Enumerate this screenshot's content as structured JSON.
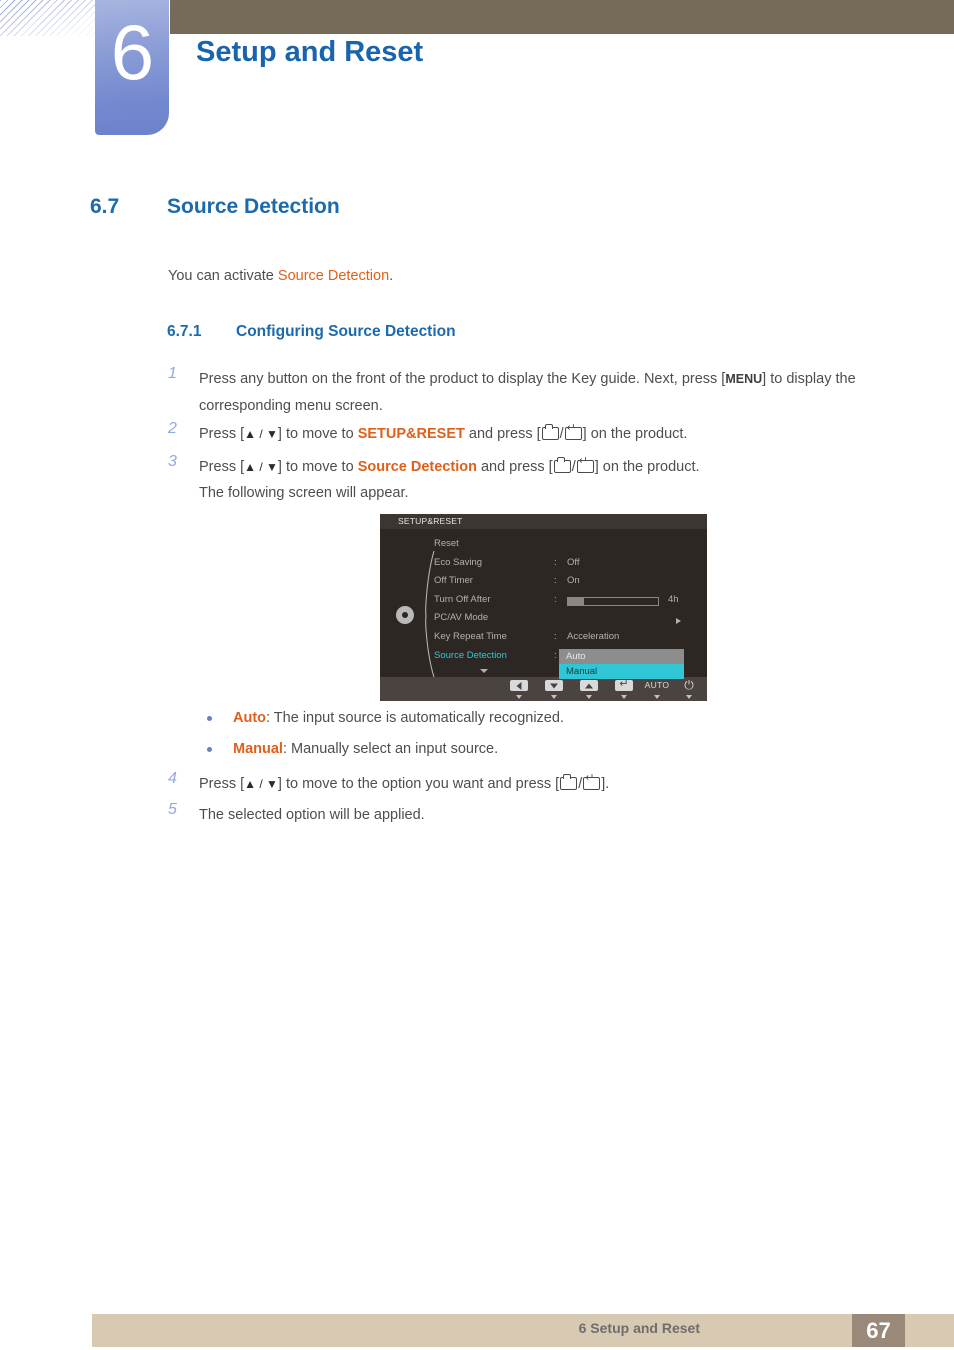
{
  "header": {
    "chapter_number": "6",
    "chapter_title": "Setup and Reset"
  },
  "section": {
    "number": "6.7",
    "title": "Source Detection",
    "intro_prefix": "You can activate ",
    "intro_highlight": "Source Detection",
    "intro_suffix": "."
  },
  "subsection": {
    "number": "6.7.1",
    "title": "Configuring Source Detection"
  },
  "steps": [
    {
      "num": "1",
      "part1": "Press any button on the front of the product to display the Key guide. Next, press [",
      "keycap": "MENU",
      "part2": "] to display the corresponding menu screen."
    },
    {
      "num": "2",
      "part1": "Press [",
      "arrows": "▲ / ▼",
      "part2": "] to move to ",
      "target": "SETUP&RESET",
      "part3": " and press [",
      "part4": "] on the product."
    },
    {
      "num": "3",
      "part1": "Press [",
      "arrows": "▲ / ▼",
      "part2": "] to move to ",
      "target": "Source Detection",
      "part3": " and press [",
      "part4": "] on the product.",
      "note": "The following screen will appear."
    },
    {
      "num": "4",
      "part1": "Press [",
      "arrows": "▲ / ▼",
      "part2": "] to move to the option you want and press [",
      "part4": "]."
    },
    {
      "num": "5",
      "part1": "The selected option will be applied."
    }
  ],
  "bullets": [
    {
      "term": "Auto",
      "desc": ": The input source is automatically recognized."
    },
    {
      "term": "Manual",
      "desc": ": Manually select an input source."
    }
  ],
  "osd": {
    "title": "SETUP&RESET",
    "gear_icon": "gear-icon",
    "rows": [
      {
        "label": "Reset",
        "colon": "",
        "value": ""
      },
      {
        "label": "Eco Saving",
        "colon": ":",
        "value": "Off"
      },
      {
        "label": "Off Timer",
        "colon": ":",
        "value": "On"
      },
      {
        "label": "Turn Off After",
        "colon": ":",
        "value": "",
        "slider": true,
        "slider_label": "4h",
        "slider_percent": 18
      },
      {
        "label": "PC/AV Mode",
        "colon": "",
        "value": "",
        "arrow": true
      },
      {
        "label": "Key Repeat Time",
        "colon": ":",
        "value": "Acceleration"
      },
      {
        "label": "Source Detection",
        "colon": ":",
        "value": "",
        "active": true
      }
    ],
    "popup": {
      "options": [
        "Auto",
        "Manual"
      ],
      "selected": "Manual"
    },
    "buttons": [
      {
        "name": "left-arrow-button",
        "glyph": "left"
      },
      {
        "name": "down-arrow-button",
        "glyph": "down"
      },
      {
        "name": "up-arrow-button",
        "glyph": "up"
      },
      {
        "name": "enter-button",
        "glyph": "enter"
      },
      {
        "name": "auto-button",
        "glyph": "text",
        "label": "AUTO"
      },
      {
        "name": "power-button",
        "glyph": "power",
        "label": "⏻"
      }
    ]
  },
  "footer": {
    "text": "6 Setup and Reset",
    "page": "67"
  },
  "colors": {
    "heading_blue": "#1a6aad",
    "chapter_blue": "#1964ad",
    "accent_orange": "#e0601b",
    "brown_bar": "#766a59",
    "footer_bar": "#d8c9b2",
    "footer_page_box": "#9a8979",
    "osd_bg": "#2d2724",
    "osd_highlight": "#2fc6d6",
    "step_number": "#93a8e2"
  }
}
